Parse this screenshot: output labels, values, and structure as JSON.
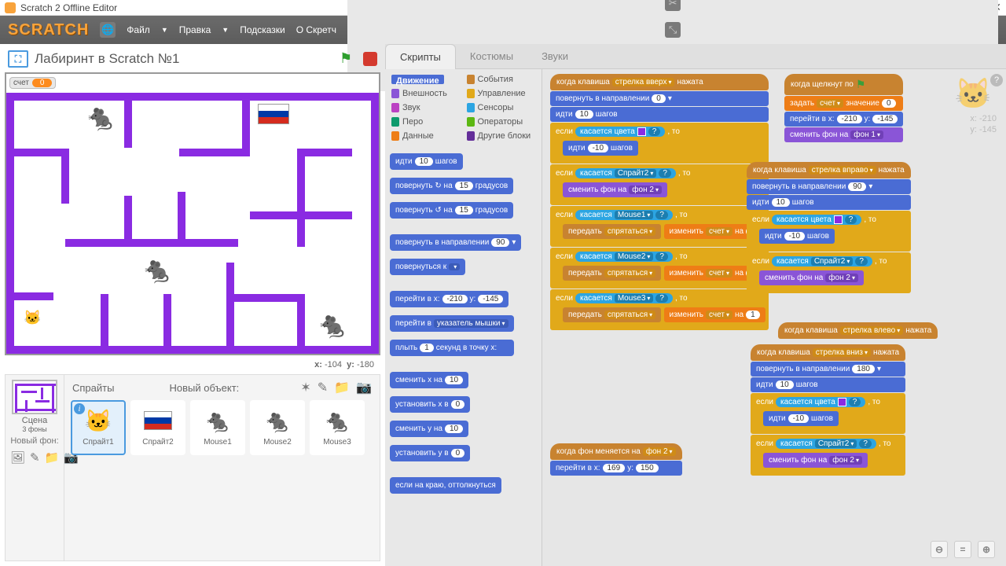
{
  "window": {
    "title": "Scratch 2 Offline Editor"
  },
  "menu": {
    "file": "Файл",
    "edit": "Правка",
    "tips": "Подсказки",
    "about": "О Скретч"
  },
  "project": {
    "title": "Лабиринт в Scratch №1",
    "score_label": "счет",
    "score_value": "0"
  },
  "coords": {
    "x_label": "x:",
    "x": "-104",
    "y_label": "y:",
    "y": "-180"
  },
  "sprite_xy": {
    "x": "-210",
    "y": "-145"
  },
  "spritepanel": {
    "sprites_label": "Спрайты",
    "new_object": "Новый объект:",
    "stage_label": "Сцена",
    "stage_sub": "3 фоны",
    "new_bg": "Новый фон:",
    "list": [
      {
        "name": "Спрайт1"
      },
      {
        "name": "Спрайт2"
      },
      {
        "name": "Mouse1"
      },
      {
        "name": "Mouse2"
      },
      {
        "name": "Mouse3"
      }
    ]
  },
  "tabs": {
    "scripts": "Скрипты",
    "costumes": "Костюмы",
    "sounds": "Звуки"
  },
  "categories": {
    "motion": "Движение",
    "looks": "Внешность",
    "sound": "Звук",
    "pen": "Перо",
    "data": "Данные",
    "events": "События",
    "control": "Управление",
    "sensing": "Сенсоры",
    "operators": "Операторы",
    "more": "Другие блоки"
  },
  "colors": {
    "motion": "#4a6cd4",
    "looks": "#8a55d7",
    "sound": "#bb42c3",
    "pen": "#0e9a6c",
    "data": "#ee7d16",
    "events": "#c88330",
    "control": "#e1a91a",
    "sensing": "#2ca5e2",
    "operators": "#5cb712",
    "more": "#632d99"
  },
  "palette_blocks": {
    "move": "идти",
    "steps": "шагов",
    "steps_n": "10",
    "turn_cw": "повернуть ↻ на",
    "turn_ccw": "повернуть ↺ на",
    "deg": "градусов",
    "deg_n": "15",
    "point_dir": "повернуть в направлении",
    "dir_n": "90",
    "point_to": "повернуться к",
    "goto_xy": "перейти в x:",
    "goto_x": "-210",
    "goto_y_lbl": "y:",
    "goto_y": "-145",
    "goto": "перейти в",
    "mouse_pointer": "указатель мышки",
    "glide": "плыть",
    "glide_n": "1",
    "glide_txt": "секунд в точку x:",
    "change_x": "сменить x на",
    "change_n": "10",
    "set_x": "установить x в",
    "zero": "0",
    "change_y": "сменить y на",
    "set_y": "установить y в",
    "edge": "если на краю, оттолкнуться"
  },
  "txt": {
    "when_key": "когда клавиша",
    "pressed": "нажата",
    "up": "стрелка вверх",
    "down": "стрелка вниз",
    "left": "стрелка влево",
    "right": "стрелка вправо",
    "point_dir": "повернуть в направлении",
    "move": "идти",
    "steps": "шагов",
    "if": "если",
    "then": ", то",
    "touch_color": "касается цвета",
    "q": "?",
    "touches": "касается",
    "broadcast": "передать",
    "hide": "спрятаться",
    "change": "изменить",
    "by": "на",
    "score": "счет",
    "set": "задать",
    "value": "значение",
    "goto_x": "перейти в x:",
    "y": "y:",
    "switch_bg": "сменить фон на",
    "bg1": "фон 1",
    "bg2": "фон 2",
    "when_flag": "когда щелкнут по",
    "when_bg": "когда фон меняется на",
    "sprite2": "Спрайт2",
    "m1": "Mouse1",
    "m2": "Mouse2",
    "m3": "Mouse3",
    "n10": "10",
    "nm10": "-10",
    "n0": "0",
    "n1": "1",
    "n90": "90",
    "n180": "180",
    "gx1": "169",
    "gy1": "150",
    "gx2": "-210",
    "gy2": "-145"
  }
}
